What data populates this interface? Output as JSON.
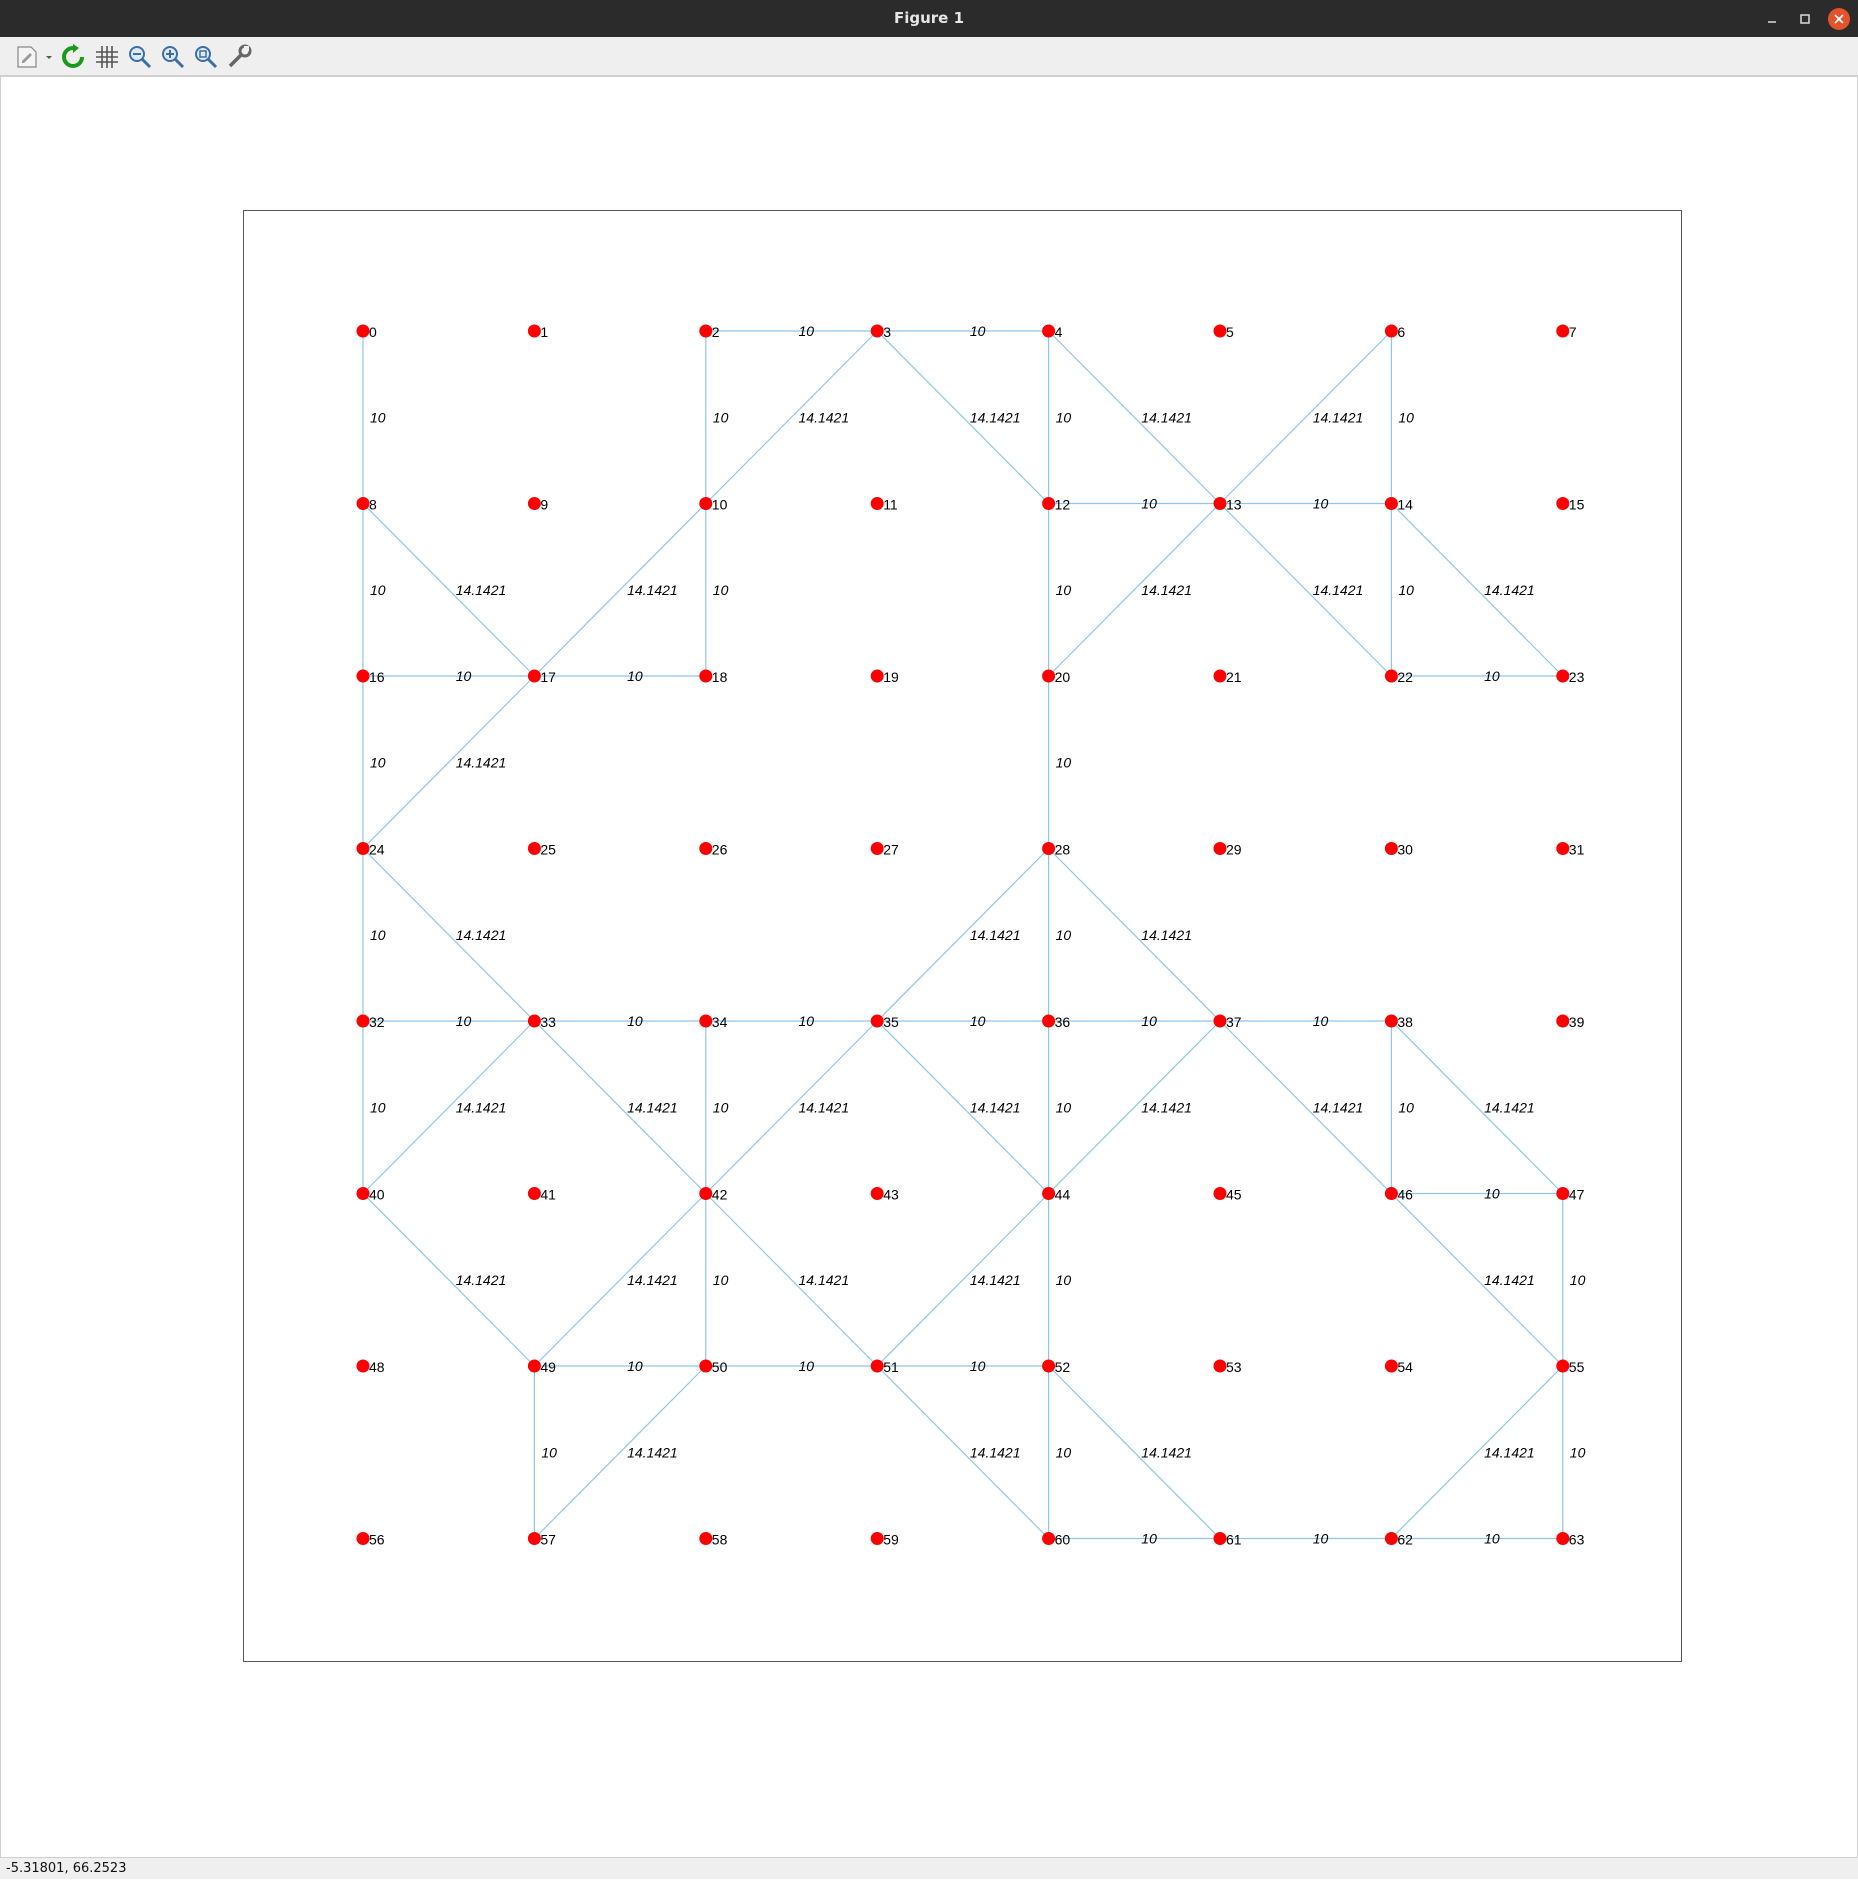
{
  "window": {
    "title": "Figure 1"
  },
  "toolbar": {
    "items": [
      {
        "icon": "new-figure-icon"
      },
      {
        "icon": "refresh-icon"
      },
      {
        "icon": "grid-icon"
      },
      {
        "icon": "zoom-out-icon"
      },
      {
        "icon": "zoom-in-icon"
      },
      {
        "icon": "zoom-fit-icon"
      },
      {
        "icon": "settings-wrench-icon"
      }
    ]
  },
  "status": {
    "coordinates": "-5.31801,  66.2523"
  },
  "colors": {
    "node": "#ff0000",
    "edge": "#8ec5ec",
    "titlebar": "#2b2b2b",
    "close": "#e5532d"
  },
  "chart_data": {
    "type": "scatter",
    "grid_columns": 8,
    "nodes": [
      0,
      1,
      2,
      3,
      4,
      5,
      6,
      7,
      8,
      9,
      10,
      11,
      12,
      13,
      14,
      15,
      16,
      17,
      18,
      19,
      20,
      21,
      22,
      23,
      24,
      25,
      26,
      27,
      28,
      29,
      30,
      31,
      32,
      33,
      34,
      35,
      36,
      37,
      38,
      39,
      40,
      41,
      42,
      43,
      44,
      45,
      46,
      47,
      48,
      49,
      50,
      51,
      52,
      53,
      54,
      55,
      56,
      57,
      58,
      59,
      60,
      61,
      62,
      63
    ],
    "edges": [
      {
        "from": 2,
        "to": 3,
        "label": "10"
      },
      {
        "from": 3,
        "to": 4,
        "label": "10"
      },
      {
        "from": 0,
        "to": 8,
        "label": "10"
      },
      {
        "from": 2,
        "to": 10,
        "label": "10"
      },
      {
        "from": 3,
        "to": 10,
        "label": "14.1421"
      },
      {
        "from": 3,
        "to": 12,
        "label": "14.1421"
      },
      {
        "from": 4,
        "to": 12,
        "label": "10"
      },
      {
        "from": 4,
        "to": 13,
        "label": "14.1421"
      },
      {
        "from": 6,
        "to": 13,
        "label": "14.1421"
      },
      {
        "from": 6,
        "to": 14,
        "label": "10"
      },
      {
        "from": 12,
        "to": 13,
        "label": "10"
      },
      {
        "from": 13,
        "to": 14,
        "label": "10"
      },
      {
        "from": 8,
        "to": 16,
        "label": "10"
      },
      {
        "from": 8,
        "to": 17,
        "label": "14.1421"
      },
      {
        "from": 10,
        "to": 17,
        "label": "14.1421"
      },
      {
        "from": 10,
        "to": 18,
        "label": "10"
      },
      {
        "from": 12,
        "to": 20,
        "label": "10"
      },
      {
        "from": 13,
        "to": 20,
        "label": "14.1421"
      },
      {
        "from": 13,
        "to": 22,
        "label": "14.1421"
      },
      {
        "from": 14,
        "to": 22,
        "label": "10"
      },
      {
        "from": 14,
        "to": 23,
        "label": "14.1421"
      },
      {
        "from": 16,
        "to": 17,
        "label": "10"
      },
      {
        "from": 17,
        "to": 18,
        "label": "10"
      },
      {
        "from": 22,
        "to": 23,
        "label": "10"
      },
      {
        "from": 16,
        "to": 24,
        "label": "10"
      },
      {
        "from": 17,
        "to": 24,
        "label": "14.1421"
      },
      {
        "from": 20,
        "to": 28,
        "label": "10"
      },
      {
        "from": 24,
        "to": 32,
        "label": "10"
      },
      {
        "from": 24,
        "to": 33,
        "label": "14.1421"
      },
      {
        "from": 28,
        "to": 35,
        "label": "14.1421"
      },
      {
        "from": 28,
        "to": 36,
        "label": "10"
      },
      {
        "from": 28,
        "to": 37,
        "label": "14.1421"
      },
      {
        "from": 32,
        "to": 33,
        "label": "10"
      },
      {
        "from": 33,
        "to": 34,
        "label": "10"
      },
      {
        "from": 34,
        "to": 35,
        "label": "10"
      },
      {
        "from": 35,
        "to": 36,
        "label": "10"
      },
      {
        "from": 36,
        "to": 37,
        "label": "10"
      },
      {
        "from": 37,
        "to": 38,
        "label": "10"
      },
      {
        "from": 32,
        "to": 40,
        "label": "10"
      },
      {
        "from": 33,
        "to": 40,
        "label": "14.1421"
      },
      {
        "from": 33,
        "to": 42,
        "label": "14.1421"
      },
      {
        "from": 34,
        "to": 42,
        "label": "10"
      },
      {
        "from": 35,
        "to": 42,
        "label": "14.1421"
      },
      {
        "from": 35,
        "to": 44,
        "label": "14.1421"
      },
      {
        "from": 36,
        "to": 44,
        "label": "10"
      },
      {
        "from": 37,
        "to": 44,
        "label": "14.1421"
      },
      {
        "from": 37,
        "to": 46,
        "label": "14.1421"
      },
      {
        "from": 38,
        "to": 46,
        "label": "10"
      },
      {
        "from": 38,
        "to": 47,
        "label": "14.1421"
      },
      {
        "from": 46,
        "to": 47,
        "label": "10"
      },
      {
        "from": 40,
        "to": 49,
        "label": "14.1421"
      },
      {
        "from": 42,
        "to": 49,
        "label": "14.1421"
      },
      {
        "from": 42,
        "to": 50,
        "label": "10"
      },
      {
        "from": 42,
        "to": 51,
        "label": "14.1421"
      },
      {
        "from": 44,
        "to": 51,
        "label": "14.1421"
      },
      {
        "from": 44,
        "to": 52,
        "label": "10"
      },
      {
        "from": 46,
        "to": 55,
        "label": "14.1421"
      },
      {
        "from": 47,
        "to": 55,
        "label": "10"
      },
      {
        "from": 49,
        "to": 50,
        "label": "10"
      },
      {
        "from": 50,
        "to": 51,
        "label": "10"
      },
      {
        "from": 51,
        "to": 52,
        "label": "10"
      },
      {
        "from": 49,
        "to": 57,
        "label": "10"
      },
      {
        "from": 50,
        "to": 57,
        "label": "14.1421"
      },
      {
        "from": 51,
        "to": 60,
        "label": "14.1421"
      },
      {
        "from": 52,
        "to": 60,
        "label": "10"
      },
      {
        "from": 52,
        "to": 61,
        "label": "14.1421"
      },
      {
        "from": 55,
        "to": 62,
        "label": "14.1421"
      },
      {
        "from": 55,
        "to": 63,
        "label": "10"
      },
      {
        "from": 60,
        "to": 61,
        "label": "10"
      },
      {
        "from": 61,
        "to": 62,
        "label": "10"
      },
      {
        "from": 62,
        "to": 63,
        "label": "10"
      }
    ]
  }
}
